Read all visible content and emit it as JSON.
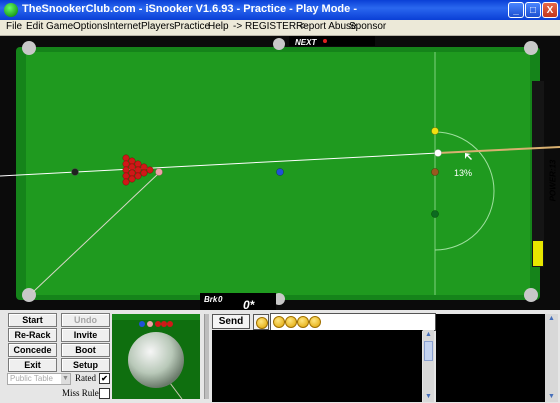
{
  "window": {
    "title": "TheSnookerClub.com - iSnooker V1.6.93 - Practice - Play Mode -",
    "controls": [
      "_",
      "□",
      "X"
    ]
  },
  "menu": [
    "File",
    "Edit",
    "Game",
    "Options",
    "Internet",
    "Players",
    "Practice",
    "Help",
    "-> REGISTER <-",
    "Report Abuse",
    "Sponsor"
  ],
  "table": {
    "next_label": "NEXT",
    "aim_percent": "13%",
    "break_label": "Brk",
    "break_value": "0",
    "score": "0*",
    "power_label": "POWER:13",
    "power_level_percent": 13,
    "colors": {
      "cloth": "#1f9a1f",
      "cushion": "#15841a",
      "rail": "#0b0b0b"
    }
  },
  "controls": {
    "start": "Start",
    "undo": "Undo",
    "rerack": "Re-Rack",
    "invite": "Invite",
    "concede": "Concede",
    "boot": "Boot",
    "exit": "Exit",
    "setup": "Setup",
    "table_type": "Public Table",
    "rated_label": "Rated",
    "rated_checked": true,
    "miss_rule_label": "Miss Rule",
    "miss_rule_checked": false
  },
  "chat": {
    "send_label": "Send",
    "emoticons": [
      "smiley-icon",
      "smiley-icon",
      "smiley-icon",
      "smiley-icon",
      "smiley-icon"
    ]
  }
}
